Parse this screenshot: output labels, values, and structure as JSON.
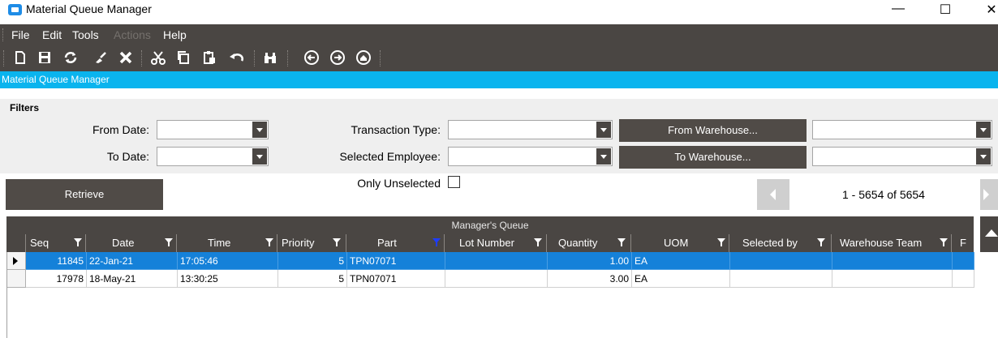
{
  "window": {
    "title": "Material Queue Manager",
    "minimize_glyph": "—",
    "maximize_glyph": "☐",
    "close_glyph": "✕"
  },
  "menu": {
    "items": [
      {
        "label": "File",
        "enabled": true
      },
      {
        "label": "Edit",
        "enabled": true
      },
      {
        "label": "Tools",
        "enabled": true
      },
      {
        "label": "Actions",
        "enabled": false
      },
      {
        "label": "Help",
        "enabled": true
      }
    ]
  },
  "toolbar": {
    "icons": [
      "new-icon",
      "save-icon",
      "refresh-icon",
      "clear-icon",
      "delete-icon",
      "cut-icon",
      "copy-icon",
      "paste-icon",
      "undo-icon",
      "search-icon",
      "back-icon",
      "forward-icon",
      "home-icon"
    ]
  },
  "module": {
    "title": "Material Queue Manager"
  },
  "filters": {
    "title": "Filters",
    "from_date_label": "From Date:",
    "to_date_label": "To Date:",
    "transaction_type_label": "Transaction Type:",
    "selected_employee_label": "Selected Employee:",
    "only_unselected_label": "Only Unselected",
    "only_unselected_checked": false,
    "from_warehouse_button": "From Warehouse...",
    "to_warehouse_button": "To Warehouse..."
  },
  "retrieve_button": "Retrieve",
  "pager": {
    "text": "1 - 5654 of 5654"
  },
  "grid": {
    "caption": "Manager's Queue",
    "columns": [
      "Seq",
      "Date",
      "Time",
      "Priority",
      "Part",
      "Lot Number",
      "Quantity",
      "UOM",
      "Selected by",
      "Warehouse Team",
      "F"
    ],
    "rows": [
      {
        "selected": true,
        "seq": "11845",
        "date": "22-Jan-21",
        "time": "17:05:46",
        "priority": "5",
        "part": "TPN07071",
        "lot_number": "",
        "quantity": "1.00",
        "uom": "EA",
        "selected_by": "",
        "warehouse_team": ""
      },
      {
        "selected": false,
        "seq": "17978",
        "date": "18-May-21",
        "time": "13:30:25",
        "priority": "5",
        "part": "TPN07071",
        "lot_number": "",
        "quantity": "3.00",
        "uom": "EA",
        "selected_by": "",
        "warehouse_team": ""
      }
    ]
  },
  "colors": {
    "dark": "#4a4643",
    "accent": "#0ab4ee",
    "selection": "#1581d9"
  }
}
